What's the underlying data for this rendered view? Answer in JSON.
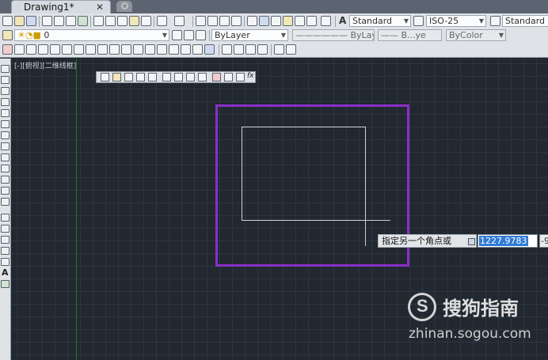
{
  "tab": {
    "title": "Drawing1*",
    "close": "✕"
  },
  "toolbar": {
    "text_style": "Standard",
    "dim_style": "ISO-25",
    "table_style": "Standard",
    "layer_value": "0",
    "color": "ByLayer",
    "linetype": "ByLayer",
    "lineweight": "B...ye",
    "plotstyle": "ByColor",
    "style_glyph": "A"
  },
  "canvas": {
    "viewport_label": "[-][俯视][二维线框]",
    "float_toolbar_fx": "fx",
    "prompt_text": "指定另一个角点或",
    "input_value": "1227.9783",
    "input2_value": "-9"
  },
  "left_tools": {
    "text_tool": "A"
  },
  "watermark": {
    "logo": "S",
    "name": "搜狗指南",
    "url": "zhinan.sogou.com"
  }
}
